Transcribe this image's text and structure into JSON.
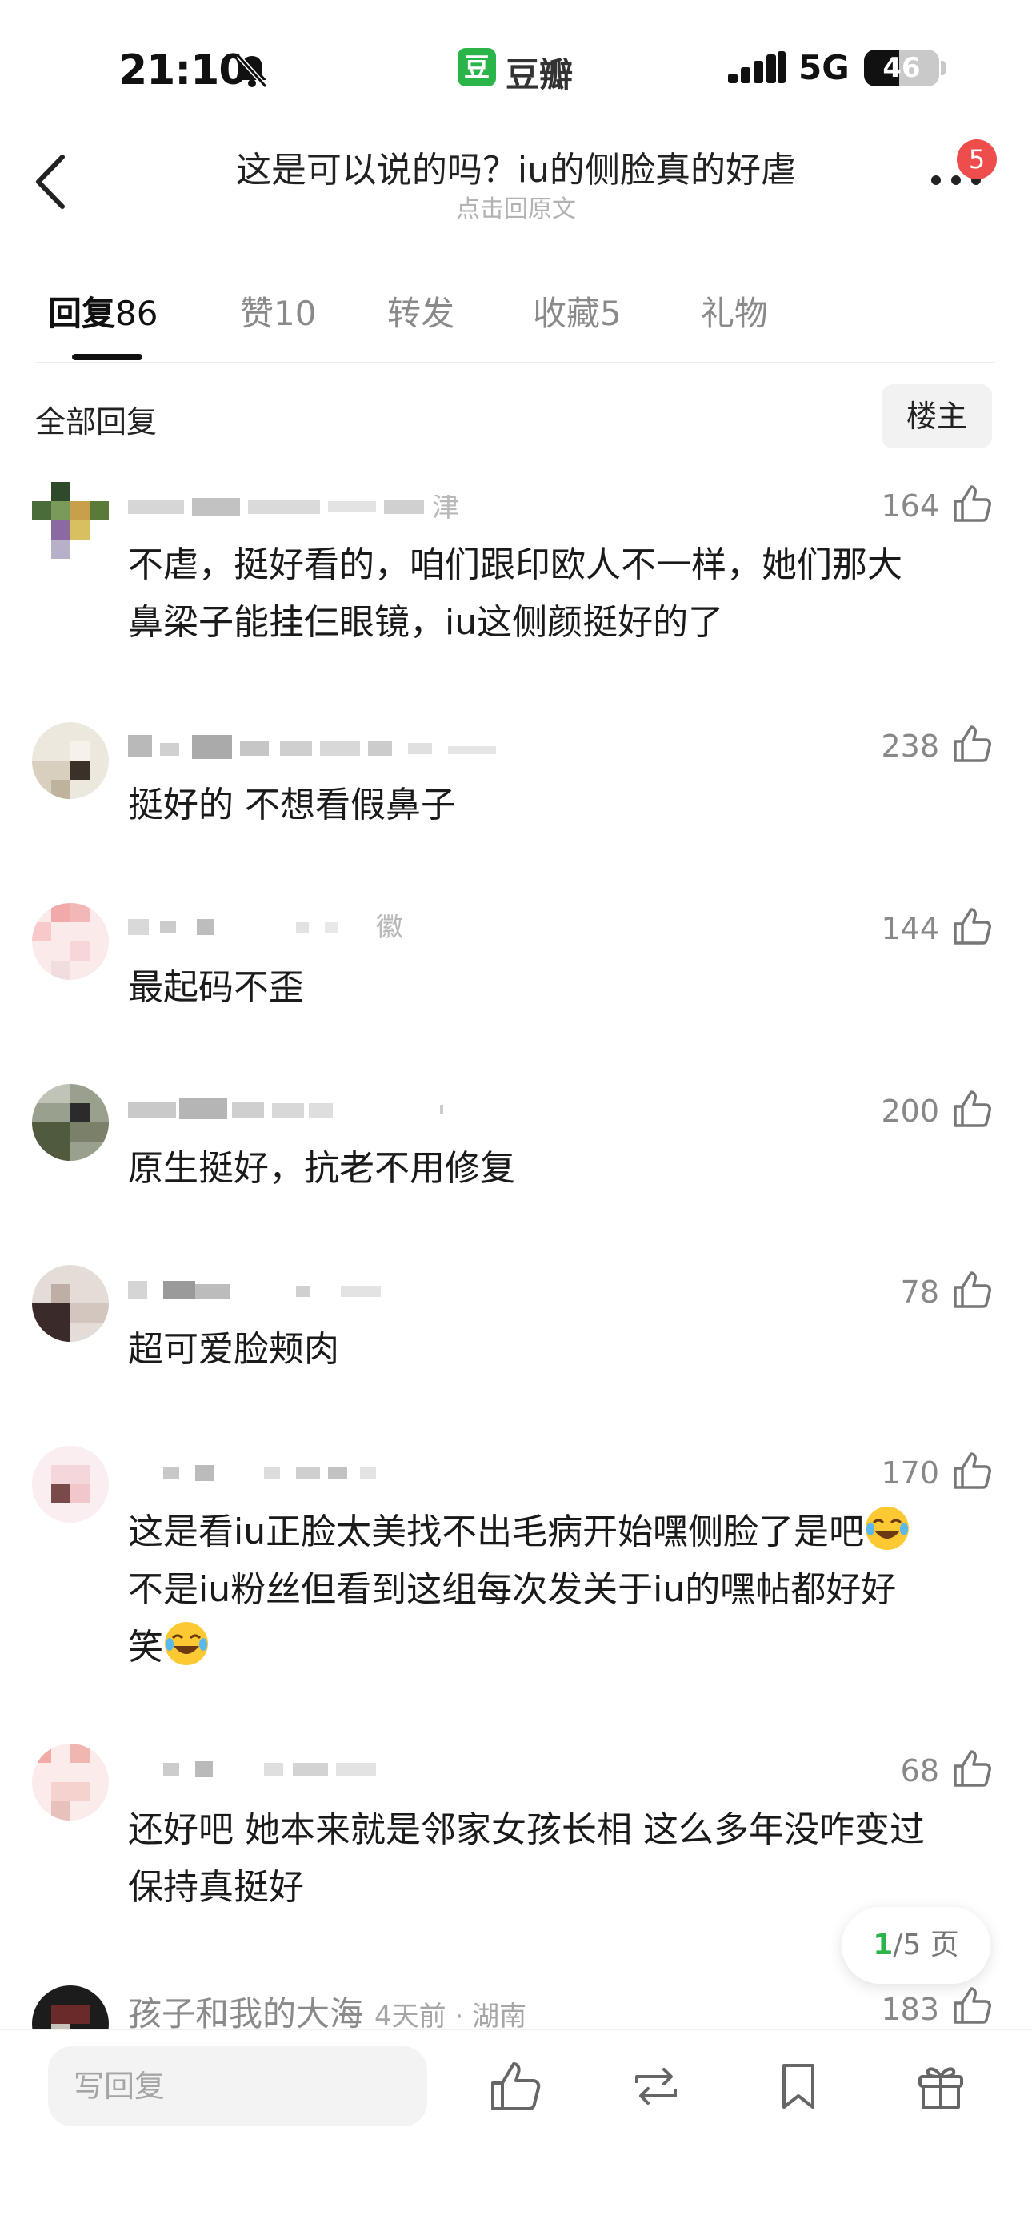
{
  "status_bar": {
    "time": "21:10",
    "app_badge": "豆",
    "app_name": "豆瓣",
    "network": "5G",
    "battery": "46",
    "icons": [
      "bell-slash-icon",
      "signal-icon",
      "battery-icon"
    ]
  },
  "nav": {
    "title": "这是可以说的吗？iu的侧脸真的好虐",
    "subtitle": "点击回原文",
    "notification_count": "5",
    "icons": [
      "back-icon",
      "more-icon"
    ]
  },
  "tabs": [
    {
      "label": "回复",
      "count": "86",
      "active": true
    },
    {
      "label": "赞",
      "count": "10",
      "active": false
    },
    {
      "label": "转发",
      "count": "",
      "active": false
    },
    {
      "label": "收藏",
      "count": "5",
      "active": false
    },
    {
      "label": "礼物",
      "count": "",
      "active": false
    }
  ],
  "filter": {
    "label": "全部回复",
    "owner_button": "楼主"
  },
  "comments": [
    {
      "name_visible": "津",
      "likes": "164",
      "lines": [
        "不虐，挺好看的，咱们跟印欧人不一样，她们那大",
        "鼻梁子能挂仨眼镜，iu这侧颜挺好的了"
      ]
    },
    {
      "name_visible": "",
      "likes": "238",
      "lines": [
        "挺好的  不想看假鼻子"
      ]
    },
    {
      "name_visible": "徽",
      "likes": "144",
      "lines": [
        "最起码不歪"
      ]
    },
    {
      "name_visible": "",
      "likes": "200",
      "lines": [
        "原生挺好，抗老不用修复"
      ]
    },
    {
      "name_visible": "",
      "likes": "78",
      "lines": [
        "超可爱脸颊肉"
      ]
    },
    {
      "name_visible": "",
      "likes": "170",
      "lines": [
        "这是看iu正脸太美找不出毛病开始嘿侧脸了是吧",
        "不是iu粉丝但看到这组每次发关于iu的嘿帖都好好",
        "笑"
      ]
    },
    {
      "name_visible": "",
      "likes": "68",
      "lines": [
        "还好吧 她本来就是邻家女孩长相 这么多年没咋变过",
        "保持真挺好"
      ]
    }
  ],
  "last_comment": {
    "name": "孩子和我的大海",
    "meta": "4天前 · 湖南",
    "likes": "183"
  },
  "pager": {
    "current": "1",
    "total": "/5 页"
  },
  "bottom_bar": {
    "reply_placeholder": "写回复",
    "icons": [
      "like-icon",
      "repost-icon",
      "bookmark-icon",
      "gift-icon"
    ]
  },
  "emoji": "joy-emoji",
  "colors": {
    "accent_green": "#2ab44a",
    "badge_red": "#ef4c4c"
  }
}
